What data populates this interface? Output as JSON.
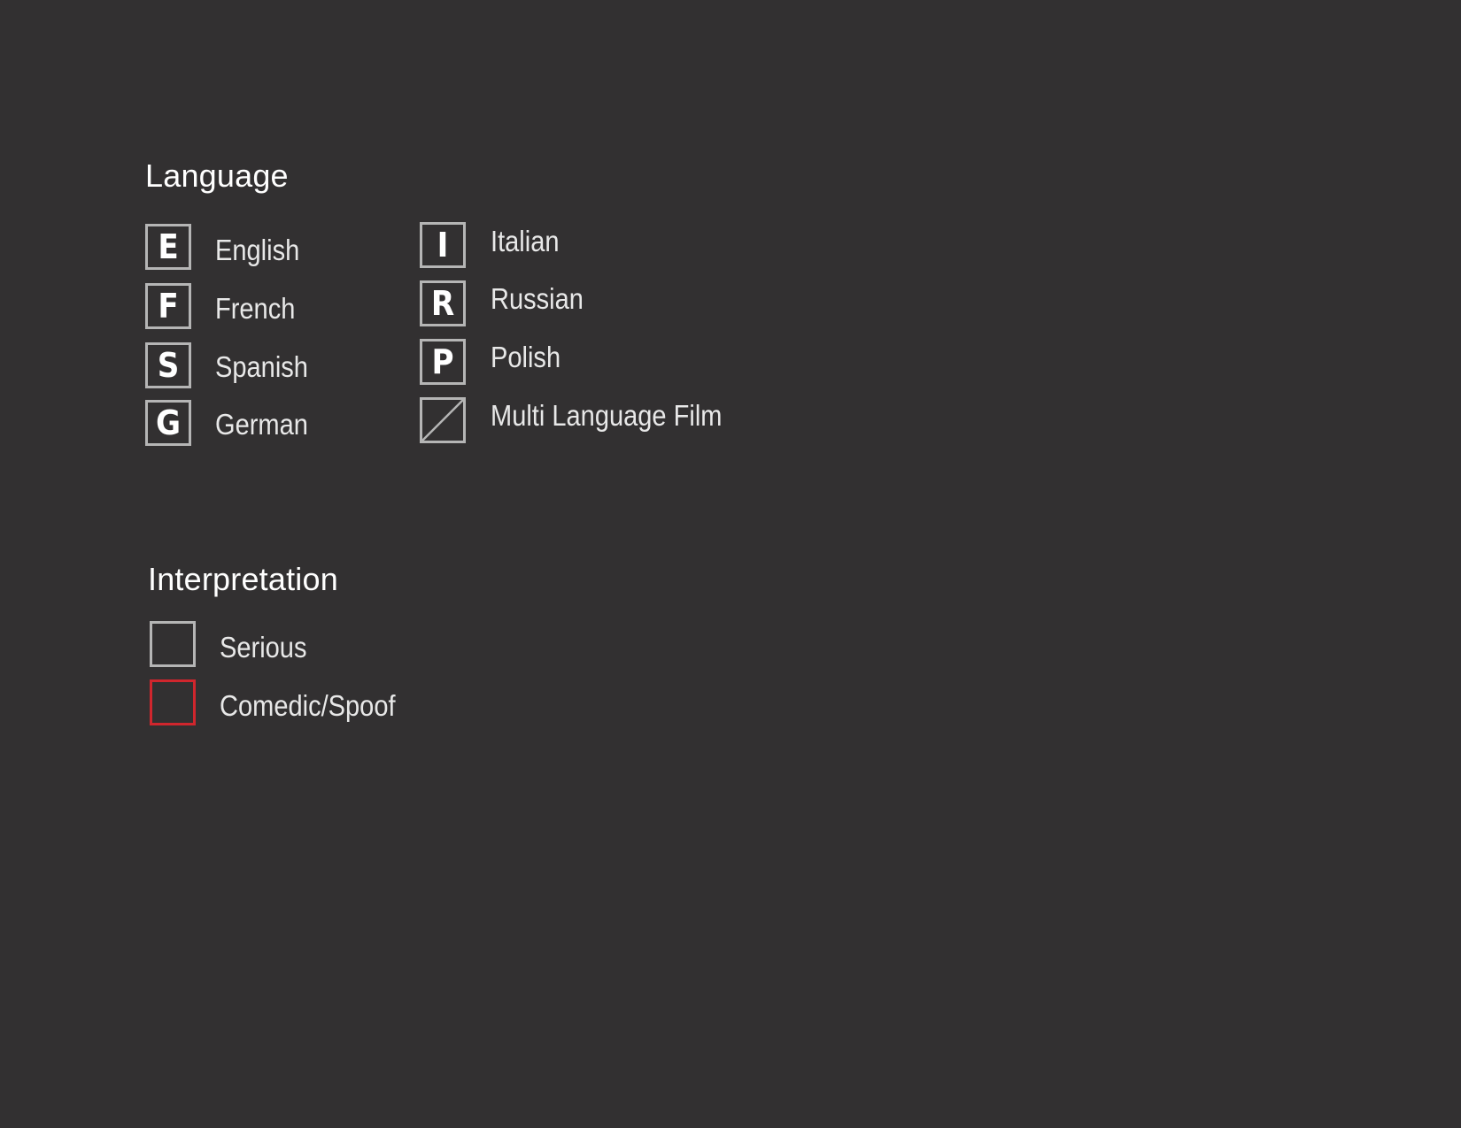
{
  "language": {
    "title": "Language",
    "items": [
      {
        "letter": "E",
        "label": "English",
        "icon": "letter-E-box-icon"
      },
      {
        "letter": "F",
        "label": "French",
        "icon": "letter-F-box-icon"
      },
      {
        "letter": "S",
        "label": "Spanish",
        "icon": "letter-S-box-icon"
      },
      {
        "letter": "G",
        "label": "German",
        "icon": "letter-G-box-icon"
      },
      {
        "letter": "I",
        "label": "Italian",
        "icon": "letter-I-box-icon"
      },
      {
        "letter": "R",
        "label": "Russian",
        "icon": "letter-R-box-icon"
      },
      {
        "letter": "P",
        "label": "Polish",
        "icon": "letter-P-box-icon"
      },
      {
        "letter": "",
        "label": "Multi Language Film",
        "icon": "diagonal-slash-box-icon"
      }
    ]
  },
  "interpretation": {
    "title": "Interpretation",
    "items": [
      {
        "label": "Serious",
        "icon": "gray-outline-box-icon",
        "color": "#b5b5b5"
      },
      {
        "label": "Comedic/Spoof",
        "icon": "red-outline-box-icon",
        "color": "#d0262d"
      }
    ]
  },
  "colors": {
    "background": "#323031",
    "box_border": "#b5b5b5",
    "comedic_accent": "#d0262d"
  }
}
